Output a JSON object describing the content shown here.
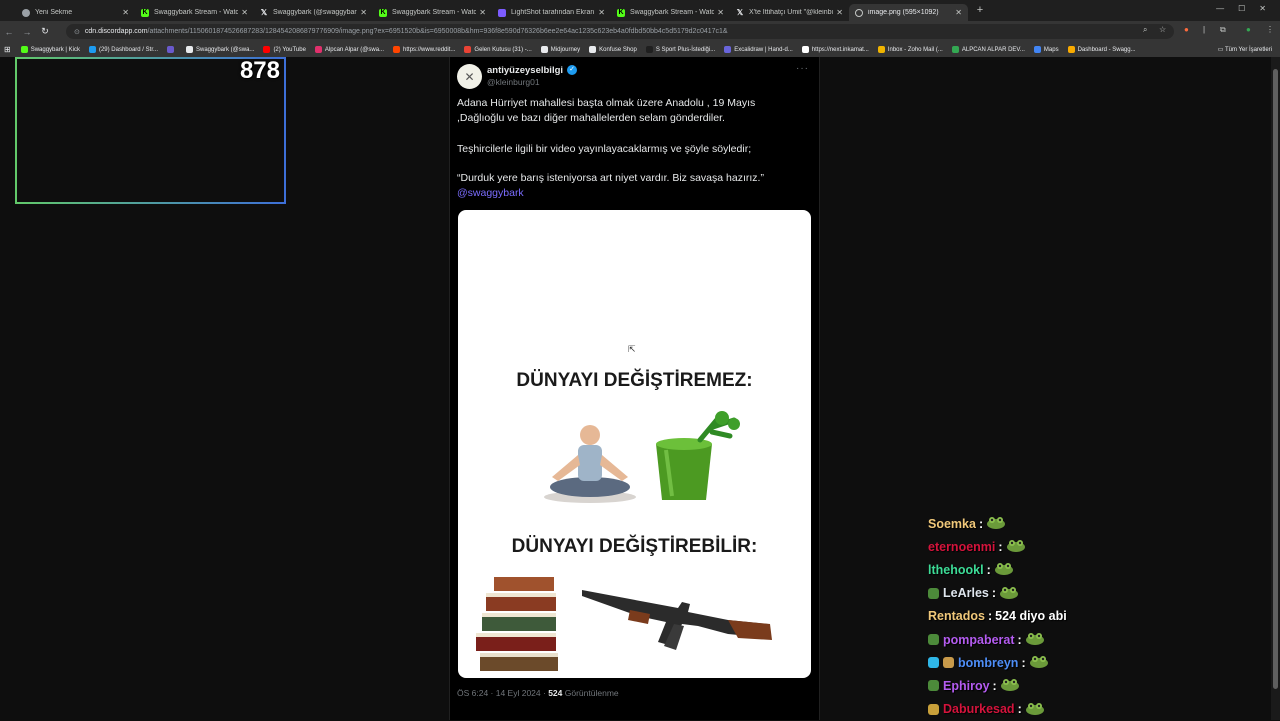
{
  "browser": {
    "tabs": [
      {
        "title": "Yeni Sekme",
        "icon": "chrome-icon",
        "active": false
      },
      {
        "title": "Swaggybark Stream - Watch Li",
        "icon": "kick-icon",
        "active": false
      },
      {
        "title": "Swaggybark (@swaggybark) / X",
        "icon": "x-icon",
        "active": false
      },
      {
        "title": "Swaggybark Stream - Watch Li",
        "icon": "kick-icon",
        "active": false
      },
      {
        "title": "LightShot tarafından Ekran Gör",
        "icon": "lightshot-icon",
        "active": false
      },
      {
        "title": "Swaggybark Stream - Watch Li",
        "icon": "kick-icon",
        "active": false
      },
      {
        "title": "X'te İttihatçı Ümit \"@kleinburg",
        "icon": "x-icon",
        "active": false
      },
      {
        "title": "image.png (595×1092)",
        "icon": "globe-icon",
        "active": true
      }
    ],
    "url_host": "cdn.discordapp.com",
    "url_path": "/attachments/1150601874526687283/1284542086879776909/image.png?ex=6951520b&is=6950008b&hm=936f8e590d76326b6ee2e64ac1235c623eb4a0fdbd50bb4c5d5179d2c0417c1&",
    "bookmarks": [
      {
        "label": "Swaggybark | Kick",
        "color": "#53fc18"
      },
      {
        "label": "(29) Dashboard / Str...",
        "color": "#1d9bf0"
      },
      {
        "label": "",
        "color": "#6a5acd"
      },
      {
        "label": "Swaggybark (@swa...",
        "color": "#e8eaed"
      },
      {
        "label": "(2) YouTube",
        "color": "#ff0000"
      },
      {
        "label": "Alpcan Alpar (@swa...",
        "color": "#e1306c"
      },
      {
        "label": "https://www.reddit...",
        "color": "#ff4500"
      },
      {
        "label": "Gelen Kutusu (31) -...",
        "color": "#ea4335"
      },
      {
        "label": "Midjourney",
        "color": "#e8eaed"
      },
      {
        "label": "Konfuse Shop",
        "color": "#e8eaed"
      },
      {
        "label": "S Sport Plus-İstediği...",
        "color": "#1f1f1f"
      },
      {
        "label": "Excalidraw | Hand-d...",
        "color": "#6965db"
      },
      {
        "label": "https://next.inkamat...",
        "color": "#ffffff"
      },
      {
        "label": "Inbox - Zoho Mail (...",
        "color": "#f0b400"
      },
      {
        "label": "ALPCAN ALPAR DEV...",
        "color": "#34a853"
      },
      {
        "label": "Maps",
        "color": "#4285f4"
      },
      {
        "label": "Dashboard - Swagg...",
        "color": "#f9ab00"
      }
    ],
    "all_bookmarks": "Tüm Yer İşaretleri"
  },
  "overlay": {
    "counter": "878"
  },
  "tweet": {
    "name": "antiyüzeyselbilgi",
    "handle": "@kleinburg01",
    "lines": [
      "Adana Hürriyet mahallesi başta olmak üzere Anadolu , 19 Mayıs",
      ",Dağlıoğlu ve bazı diğer mahallelerden selam gönderdiler.",
      "Teşhircilerle ilgili bir video yayınlayacaklarmış ve şöyle söyledir;",
      "“Durduk yere barış isteniyorsa art niyet vardır. Biz savaşa hazırız.”"
    ],
    "mention": "@swaggybark",
    "meme_top": "DÜNYAYI DEĞİŞTİREMEZ:",
    "meme_bottom": "DÜNYAYI DEĞİŞTİREBİLİR:",
    "time": "ÖS 6:24 · 14 Eyl 2024 ·",
    "views": "524",
    "views_label": "Görüntülenme"
  },
  "chat": [
    {
      "user": "Soemka",
      "color": "#f0c87a",
      "text": "",
      "badges": [],
      "emote": true
    },
    {
      "user": "eternoenmi",
      "color": "#d4143c",
      "text": "",
      "badges": [],
      "emote": true
    },
    {
      "user": "lthehookl",
      "color": "#3ddc97",
      "text": "",
      "badges": [],
      "emote": true
    },
    {
      "user": "LeArles",
      "color": "#dfe6ee",
      "text": "",
      "badges": [
        "#4c8a3a"
      ],
      "emote": true
    },
    {
      "user": "Rentados",
      "color": "#f0c87a",
      "text": "524 diyo abi",
      "badges": [],
      "emote": false
    },
    {
      "user": "pompaberat",
      "color": "#b45cf0",
      "text": "",
      "badges": [
        "#4c8a3a"
      ],
      "emote": true
    },
    {
      "user": "bombreyn",
      "color": "#4e8ef7",
      "text": "",
      "badges": [
        "#2fb7e8",
        "#c89a4a"
      ],
      "emote": true
    },
    {
      "user": "Ephiroy",
      "color": "#b45cf0",
      "text": "",
      "badges": [
        "#4c8a3a"
      ],
      "emote": true
    },
    {
      "user": "Daburkesad",
      "color": "#d4143c",
      "text": "",
      "badges": [
        "#c8a03a"
      ],
      "emote": true
    }
  ]
}
